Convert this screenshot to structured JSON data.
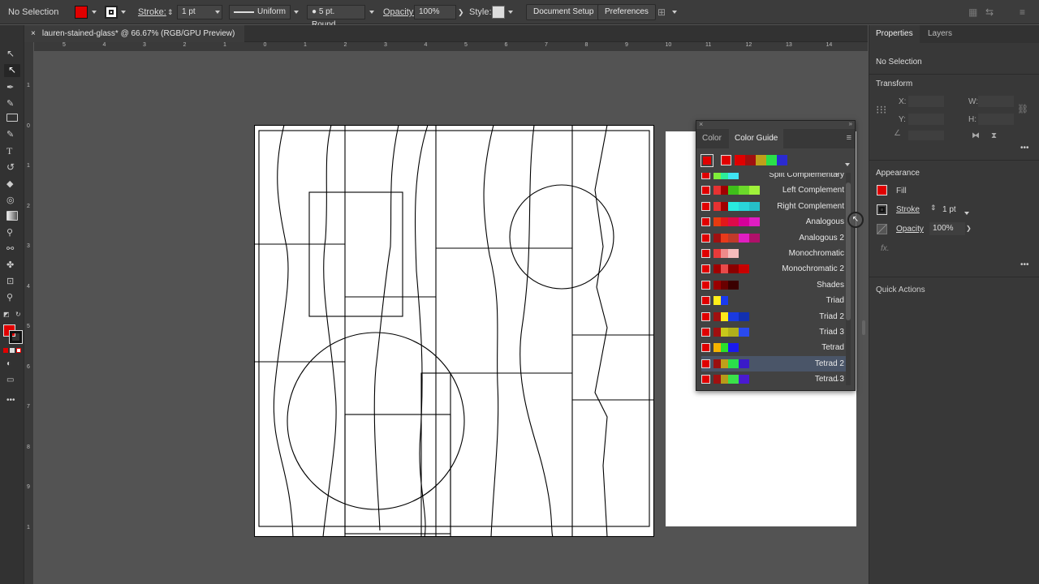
{
  "control_bar": {
    "selection": "No Selection",
    "stroke_label": "Stroke:",
    "stroke_weight": "1 pt",
    "stroke_profile": "Uniform",
    "brush": "5 pt. Round",
    "opacity_label": "Opacity:",
    "opacity": "100%",
    "style_label": "Style:",
    "document_setup": "Document Setup",
    "preferences": "Preferences"
  },
  "document_tab": {
    "title": "lauren-stained-glass* @ 66.67% (RGB/GPU Preview)",
    "close": "×"
  },
  "ruler_numbers": [
    "5",
    "4",
    "3",
    "2",
    "1",
    "0",
    "1",
    "2",
    "3",
    "4",
    "5",
    "6",
    "7",
    "8",
    "9",
    "10",
    "11",
    "12",
    "13",
    "14"
  ],
  "vruler_numbers": [
    "1",
    "0",
    "1",
    "2",
    "3",
    "4",
    "5",
    "6",
    "7",
    "8",
    "9",
    "1"
  ],
  "color_guide": {
    "tabs": [
      "Color",
      "Color Guide"
    ],
    "rows": [
      {
        "label": "Split Complementary",
        "colors": [
          "#e00000",
          "#7fef3a",
          "#2bef9a",
          "#3fe4f2"
        ]
      },
      {
        "label": "Left Complement",
        "colors": [
          "#e00000",
          "#e63232",
          "#a00000",
          "#3fbf1a",
          "#6bd92a",
          "#a0f23a"
        ]
      },
      {
        "label": "Right Complement",
        "colors": [
          "#e00000",
          "#e63232",
          "#a00000",
          "#29eae0",
          "#2ad4da",
          "#26bfc8"
        ]
      },
      {
        "label": "Analogous",
        "colors": [
          "#e00000",
          "#e63a10",
          "#e3171a",
          "#dd0a4a",
          "#d4009a",
          "#e01ec2"
        ]
      },
      {
        "label": "Analogous 2",
        "colors": [
          "#e00000",
          "#a01010",
          "#e83a1a",
          "#c03a2a",
          "#e01ec0",
          "#b0106a"
        ]
      },
      {
        "label": "Monochromatic",
        "colors": [
          "#e00000",
          "#e83a3a",
          "#f08a8a",
          "#f6bcbc"
        ]
      },
      {
        "label": "Monochromatic 2",
        "colors": [
          "#e00000",
          "#a00000",
          "#e84a4a",
          "#8a0000",
          "#c80000"
        ]
      },
      {
        "label": "Shades",
        "colors": [
          "#e00000",
          "#9a0000",
          "#6a0000",
          "#3a0000"
        ]
      },
      {
        "label": "Triad",
        "colors": [
          "#e00000",
          "#ffef1a",
          "#1a3aef"
        ]
      },
      {
        "label": "Triad 2",
        "colors": [
          "#e00000",
          "#a01010",
          "#ffe81a",
          "#1a3ae0",
          "#1230b0"
        ]
      },
      {
        "label": "Triad 3",
        "colors": [
          "#e00000",
          "#a01010",
          "#c8c81a",
          "#b0b01a",
          "#2a4aef"
        ]
      },
      {
        "label": "Tetrad",
        "colors": [
          "#e00000",
          "#f5b400",
          "#2ae02a",
          "#1a1aef"
        ]
      },
      {
        "label": "Tetrad 2",
        "colors": [
          "#e00000",
          "#9a1010",
          "#c0a01a",
          "#2adf4a",
          "#3a1ac8"
        ]
      },
      {
        "label": "Tetrad 3",
        "colors": [
          "#e00000",
          "#a01010",
          "#b89a1a",
          "#3ae04a",
          "#4a1ad0"
        ]
      }
    ],
    "active_colors": [
      "#e00000",
      "#e00000",
      "#a01010",
      "#c0a01a",
      "#2adf4a",
      "#2a2ad0"
    ]
  },
  "properties": {
    "tabs": [
      "Properties",
      "Layers"
    ],
    "selection": "No Selection",
    "transform": "Transform",
    "x_label": "X:",
    "y_label": "Y:",
    "w_label": "W:",
    "h_label": "H:",
    "appearance": "Appearance",
    "fill": "Fill",
    "stroke": "Stroke",
    "stroke_weight": "1 pt",
    "opacity": "Opacity",
    "opacity_value": "100%",
    "fx": "fx.",
    "quick_actions": "Quick Actions"
  },
  "colors": {
    "fill": "#e00000",
    "selected_row": "#4a5568"
  }
}
